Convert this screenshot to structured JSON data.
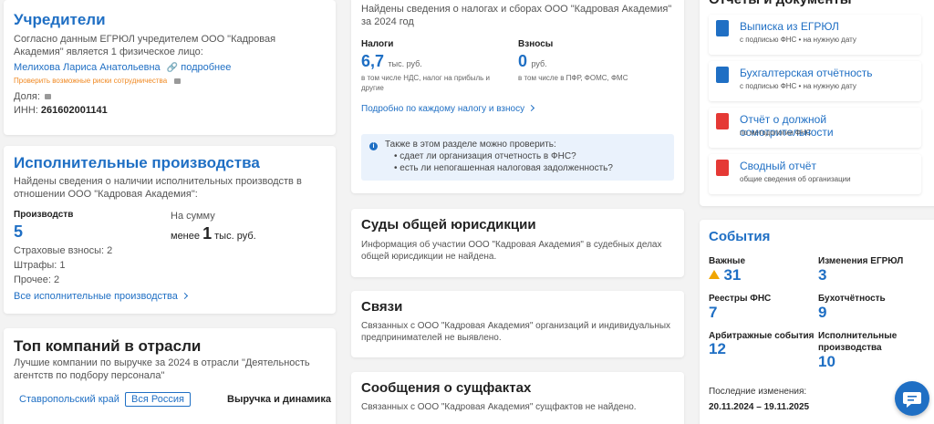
{
  "founders": {
    "title": "Учредители",
    "text": "Согласно данным ЕГРЮЛ учредителем ООО \"Кадровая Академия\" является 1 физическое лицо:",
    "person": "Мелихова Лариса Анатольевна",
    "more_link": "подробнее",
    "risk_link": "Проверить возможные риски сотрудничества",
    "share_label": "Доля:",
    "inn_label": "ИНН:",
    "inn_value": "261602001141"
  },
  "enforcement": {
    "title": "Исполнительные производства",
    "text": "Найдены сведения о наличии исполнительных производств в отношении ООО \"Кадровая Академия\":",
    "count_label": "Производств",
    "count_value": "5",
    "sum_label": "На сумму",
    "sum_prefix": "менее",
    "sum_value": "1",
    "sum_unit": "тыс. руб.",
    "items": [
      "Страховые взносы: 2",
      "Штрафы: 1",
      "Прочее: 2"
    ],
    "all_link": "Все исполнительные производства"
  },
  "top": {
    "title": "Топ компаний в отрасли",
    "text": "Лучшие компании по выручке за 2024 в отрасли \"Деятельность агентств по подбору персонала\"",
    "region_link": "Ставропольский край",
    "russia_btn": "Вся Россия",
    "column_label": "Выручка и динамика"
  },
  "taxes": {
    "intro": "Найдены сведения о налогах и сборах ООО \"Кадровая Академия\" за 2024 год",
    "taxes_label": "Налоги",
    "taxes_value": "6,7",
    "taxes_unit": "тыс. руб.",
    "taxes_note": "в том числе НДС, налог на прибыль и другие",
    "contrib_label": "Взносы",
    "contrib_value": "0",
    "contrib_unit": "руб.",
    "contrib_note": "в том числе в ПФР, ФОМС, ФМС",
    "detail_link": "Подробно по каждому налогу и взносу",
    "info_title": "Также в этом разделе можно проверить:",
    "info_items": [
      "сдает ли организация отчетность в ФНС?",
      "есть ли непогашенная налоговая задолженность?"
    ]
  },
  "courts": {
    "title": "Суды общей юрисдикции",
    "text": "Информация об участии ООО \"Кадровая Академия\" в судебных делах общей юрисдикции не найдена."
  },
  "links": {
    "title": "Связи",
    "text": "Связанных с ООО \"Кадровая Академия\" организаций и индивидуальных предпринимателей не выявлено."
  },
  "facts": {
    "title": "Сообщения о сущфактах",
    "text": "Связанных с ООО \"Кадровая Академия\" сущфактов не найдено."
  },
  "reports": {
    "title": "Отчеты и документы",
    "items": [
      {
        "title": "Выписка из ЕГРЮЛ",
        "sub": "с подписью ФНС • на нужную дату",
        "icon": "document-blue-icon",
        "color": "#1f6fc4"
      },
      {
        "title": "Бухгалтерская отчётность",
        "sub": "с подписью ФНС • на нужную дату",
        "icon": "document-blue-icon",
        "color": "#1f6fc4"
      },
      {
        "title": "Отчёт о должной осмотрительности",
        "sub": "по методологии ФНС",
        "icon": "pdf-icon",
        "color": "#e53935"
      },
      {
        "title": "Сводный отчёт",
        "sub": "общие сведения об организации",
        "icon": "pdf-icon",
        "color": "#e53935"
      }
    ]
  },
  "events": {
    "title": "События",
    "important_label": "Важные",
    "important_value": "31",
    "egrul_label": "Изменения ЕГРЮЛ",
    "egrul_value": "3",
    "fns_label": "Реестры ФНС",
    "fns_value": "7",
    "acc_label": "Бухотчётность",
    "acc_value": "9",
    "arb_label": "Арбитражные события",
    "arb_value": "12",
    "exec_label": "Исполнительные производства",
    "exec_value": "10",
    "last_label": "Последние изменения:",
    "last_value": "20.11.2024 – 19.11.2025"
  },
  "colors": {
    "accent": "#1f6fc4",
    "warning": "#f0a500",
    "pdf": "#e53935",
    "orange_link": "#f08a24"
  }
}
